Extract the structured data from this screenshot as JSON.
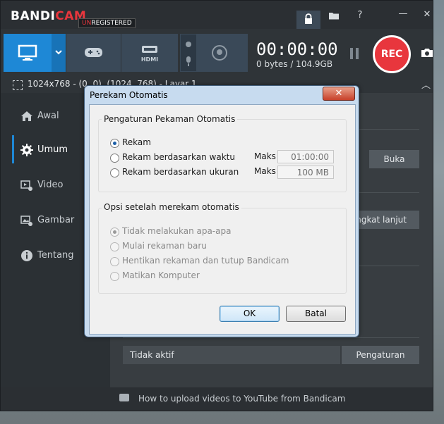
{
  "titlebar": {
    "logo_main": "BANDI",
    "logo_accent": "CAM",
    "reg_prefix": "UN",
    "reg_suffix": "REGISTERED",
    "icons": [
      "lock-icon",
      "folder-icon",
      "help-icon",
      "minimize-icon",
      "close-icon"
    ]
  },
  "toolbar": {
    "hdmi_label": "HDMI",
    "timer": "00:00:00",
    "size": "0 bytes / 104.9GB",
    "rec_label": "REC"
  },
  "status": {
    "region": "1024x768 - (0, 0), (1024, 768) - Layar 1"
  },
  "sidebar": {
    "items": [
      {
        "label": "Awal",
        "icon": "home-icon",
        "active": false
      },
      {
        "label": "Umum",
        "icon": "gear-icon",
        "active": true
      },
      {
        "label": "Video",
        "icon": "video-icon",
        "active": false
      },
      {
        "label": "Gambar",
        "icon": "image-icon",
        "active": false
      },
      {
        "label": "Tentang",
        "icon": "info-icon",
        "active": false
      }
    ]
  },
  "content": {
    "buka_label": "Buka",
    "advanced_label": "Pengaturan tingkat lanjut",
    "tidak_aktif": "Tidak aktif",
    "pengaturan_label": "Pengaturan"
  },
  "footer": {
    "text": "How to upload videos to YouTube from Bandicam"
  },
  "dialog": {
    "title": "Perekam Otomatis",
    "group1": {
      "title": "Pengaturan Pekaman Otomatis",
      "options": [
        "Rekam",
        "Rekam berdasarkan waktu",
        "Rekam berdasarkan ukuran"
      ],
      "selected": 0,
      "maks_label": "Maks",
      "time_value": "01:00:00",
      "size_value": "100 MB"
    },
    "group2": {
      "title": "Opsi setelah merekam otomatis",
      "options": [
        "Tidak melakukan apa-apa",
        "Mulai rekaman baru",
        "Hentikan rekaman dan tutup Bandicam",
        "Matikan Komputer"
      ],
      "selected": 0
    },
    "ok_label": "OK",
    "cancel_label": "Batal"
  }
}
